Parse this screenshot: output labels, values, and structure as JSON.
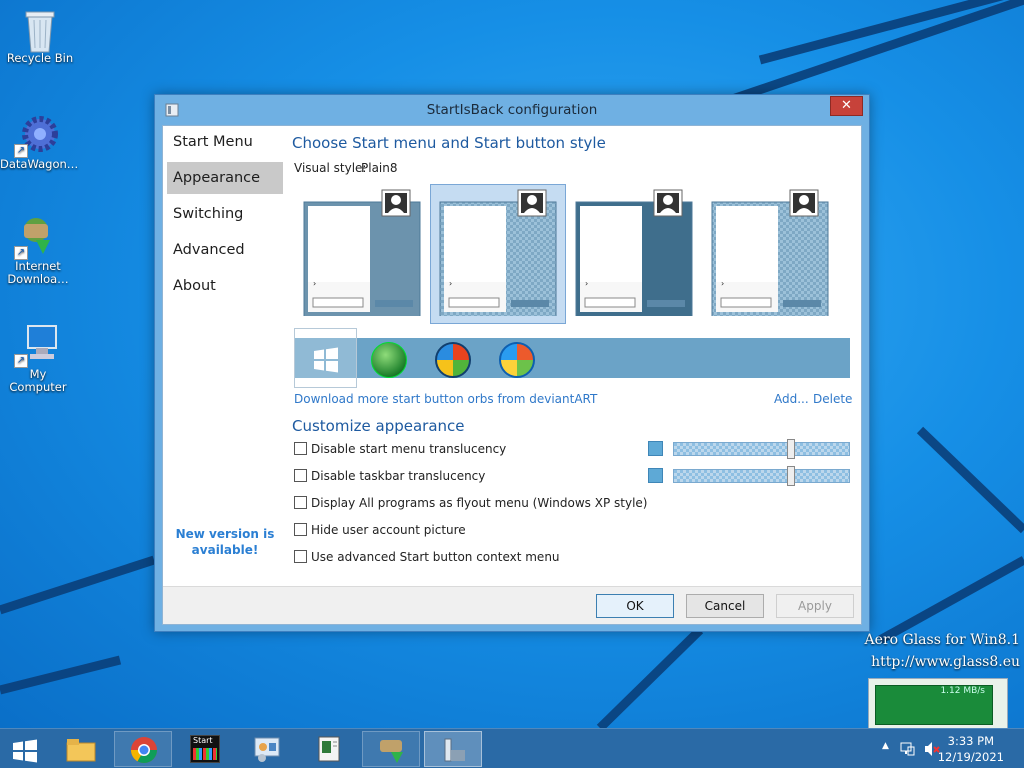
{
  "desktop": {
    "icons": [
      {
        "label": "Recycle Bin",
        "icon": "recycle-bin-icon"
      },
      {
        "label": "DataWagon…",
        "icon": "gear-icon"
      },
      {
        "label_line1": "Internet",
        "label_line2": "Downloa…",
        "icon": "download-manager-icon"
      },
      {
        "label": "My Computer",
        "icon": "computer-icon"
      }
    ]
  },
  "window": {
    "title": "StartIsBack configuration",
    "close_label": "✕",
    "nav": {
      "items": [
        "Start Menu",
        "Appearance",
        "Switching",
        "Advanced",
        "About"
      ],
      "selected": "Appearance",
      "new_version": "New version is available!"
    },
    "section1": {
      "heading": "Choose Start menu and Start button style",
      "visual_style_label": "Visual style:",
      "visual_style_value": "Plain8",
      "styles_count": 4,
      "selected_style": 2
    },
    "orbs": {
      "selected": 1,
      "names": [
        "windows8-logo",
        "shamrock-orb",
        "windows7-orb",
        "windows-vista-orb"
      ]
    },
    "links": {
      "download": "Download more start button orbs from deviantART",
      "add": "Add...",
      "delete": "Delete"
    },
    "section2": {
      "heading": "Customize appearance",
      "checkboxes": [
        {
          "label": "Disable start menu translucency",
          "checked": false
        },
        {
          "label": "Disable taskbar translucency",
          "checked": false
        },
        {
          "label": "Display All programs as flyout menu (Windows XP style)",
          "checked": false
        },
        {
          "label": "Hide user account picture",
          "checked": false
        },
        {
          "label": "Use advanced Start button context menu",
          "checked": false
        }
      ],
      "sliders": [
        {
          "color": "#5ea9d6",
          "level": 0.66
        },
        {
          "color": "#5ea9d6",
          "level": 0.66
        }
      ]
    },
    "buttons": {
      "ok": "OK",
      "cancel": "Cancel",
      "apply": "Apply"
    }
  },
  "watermark": {
    "line1": "Aero Glass for Win8.1",
    "line2": "http://www.glass8.eu"
  },
  "gadget": {
    "value": "1.12 MB/s"
  },
  "taskbar": {
    "start_icon": "windows-logo-icon",
    "items": [
      {
        "name": "file-explorer-icon",
        "state": "none"
      },
      {
        "name": "chrome-icon",
        "state": "open"
      },
      {
        "name": "start-app-icon",
        "state": "none",
        "label": "Start"
      },
      {
        "name": "control-panel-icon",
        "state": "none"
      },
      {
        "name": "document-viewer-icon",
        "state": "none"
      },
      {
        "name": "download-manager-icon",
        "state": "open"
      },
      {
        "name": "startisback-icon",
        "state": "active"
      }
    ],
    "clock": {
      "time": "3:33 PM",
      "date": "12/19/2021"
    }
  }
}
